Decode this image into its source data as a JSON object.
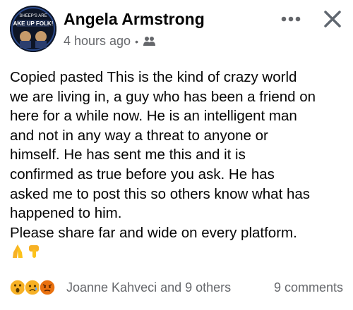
{
  "post": {
    "author": "Angela Armstrong",
    "timestamp": "4 hours ago",
    "separator": "•",
    "audience_icon": "group-icon",
    "avatar_text": [
      "SHEEP'S ARE",
      "AKE UP FOLK!"
    ],
    "menu_icon": "more-horizontal-icon",
    "close_icon": "close-icon",
    "body_lines": [
      "Copied pasted This is the kind of crazy world",
      "we are living in, a guy who has been a friend on",
      "here for a while now. He is an intelligent man",
      "and not in any way a threat to anyone or",
      "himself. He has sent me this and it is",
      "confirmed as true before you ask. He has",
      "asked me to post this so others know what has",
      "happened to him.",
      "Please share far and wide on every platform."
    ],
    "body_emojis": [
      "folded-hands-emoji",
      "backhand-index-pointing-down-emoji"
    ]
  },
  "footer": {
    "reactions": [
      "wow-reaction-icon",
      "sad-reaction-icon",
      "angry-reaction-icon"
    ],
    "reaction_names": "Joanne Kahveci and 9 others",
    "comments": "9 comments"
  },
  "colors": {
    "text": "#050505",
    "secondary_text": "#65676b",
    "emoji_yellow": "#f7b125",
    "angry_red": "#e9710f"
  }
}
